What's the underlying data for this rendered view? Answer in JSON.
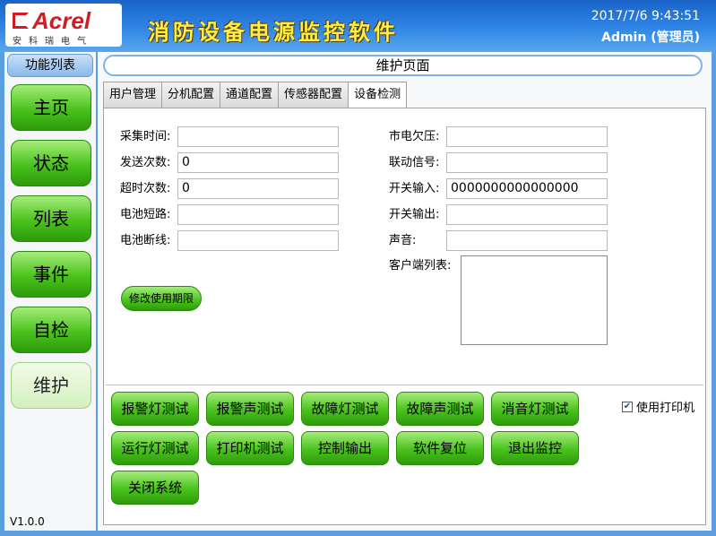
{
  "header": {
    "logo_text": "Acrel",
    "logo_sub": "安科瑞电气",
    "app_title": "消防设备电源监控软件",
    "datetime": "2017/7/6 9:43:51",
    "user": "Admin (管理员)"
  },
  "sidebar": {
    "title": "功能列表",
    "items": [
      {
        "label": "主页"
      },
      {
        "label": "状态"
      },
      {
        "label": "列表"
      },
      {
        "label": "事件"
      },
      {
        "label": "自检"
      },
      {
        "label": "维护"
      }
    ],
    "active": "维护",
    "version": "V1.0.0"
  },
  "main": {
    "page_title": "维护页面",
    "tabs": [
      {
        "label": "用户管理"
      },
      {
        "label": "分机配置"
      },
      {
        "label": "通道配置"
      },
      {
        "label": "传感器配置"
      },
      {
        "label": "设备检测"
      }
    ],
    "active_tab": "设备检测",
    "left_fields": [
      {
        "label": "采集时间:",
        "value": ""
      },
      {
        "label": "发送次数:",
        "value": "0"
      },
      {
        "label": "超时次数:",
        "value": "0"
      },
      {
        "label": "电池短路:",
        "value": ""
      },
      {
        "label": "电池断线:",
        "value": ""
      }
    ],
    "right_fields": [
      {
        "label": "市电欠压:",
        "value": ""
      },
      {
        "label": "联动信号:",
        "value": ""
      },
      {
        "label": "开关输入:",
        "value": "0000000000000000"
      },
      {
        "label": "开关输出:",
        "value": ""
      },
      {
        "label": "声音:",
        "value": ""
      }
    ],
    "client_list_label": "客户端列表:",
    "modify_button": "修改使用期限",
    "action_buttons": [
      [
        "报警灯测试",
        "报警声测试",
        "故障灯测试",
        "故障声测试",
        "消音灯测试"
      ],
      [
        "运行灯测试",
        "打印机测试",
        "控制输出",
        "软件复位",
        "退出监控"
      ],
      [
        "关闭系统"
      ]
    ],
    "printer_checkbox": {
      "label": "使用打印机",
      "checked": true
    }
  },
  "colors": {
    "header_blue": "#2f86e6",
    "button_green": "#49c21c",
    "title_yellow": "#ffee44",
    "logo_red": "#d01d24"
  }
}
